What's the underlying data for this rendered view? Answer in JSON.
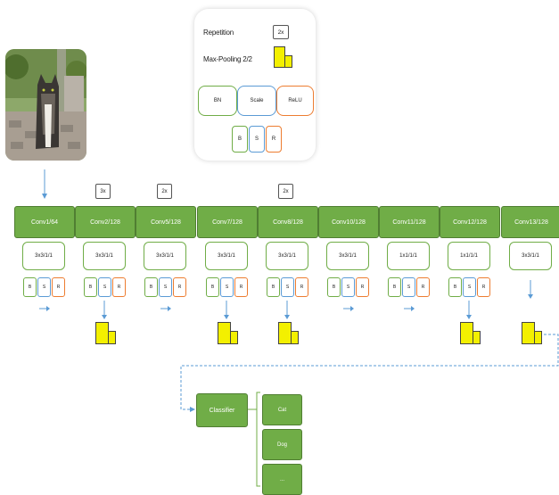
{
  "legend": {
    "repetition_label": "Repetition",
    "repetition_value": "2x",
    "maxpool_label": "Max-Pooling 2/2",
    "wide": [
      "BN",
      "Scale",
      "ReLU"
    ],
    "small": [
      "B",
      "S",
      "R"
    ]
  },
  "repeat_labels": [
    "3x",
    "2x",
    "2x"
  ],
  "layers": [
    {
      "name": "Conv1/64",
      "kernel": "3x3/1/1",
      "pool": false
    },
    {
      "name": "Conv2/128",
      "kernel": "3x3/1/1",
      "pool": true
    },
    {
      "name": "Conv5/128",
      "kernel": "3x3/1/1",
      "pool": false
    },
    {
      "name": "Conv7/128",
      "kernel": "3x3/1/1",
      "pool": true
    },
    {
      "name": "Conv8/128",
      "kernel": "3x3/1/1",
      "pool": true
    },
    {
      "name": "Conv10/128",
      "kernel": "3x3/1/1",
      "pool": false
    },
    {
      "name": "Conv11/128",
      "kernel": "1x1/1/1",
      "pool": false
    },
    {
      "name": "Conv12/128",
      "kernel": "1x1/1/1",
      "pool": true
    },
    {
      "name": "Conv13/128",
      "kernel": "3x3/1/1",
      "pool": true
    }
  ],
  "bsr": [
    "B",
    "S",
    "R"
  ],
  "classifier": {
    "label": "Classifier",
    "outputs": [
      "Cat",
      "Dog",
      "..."
    ]
  },
  "colors": {
    "green": "#70ad47",
    "blue": "#5b9bd5",
    "orange": "#ed7d31",
    "yellow": "#f3f000"
  }
}
